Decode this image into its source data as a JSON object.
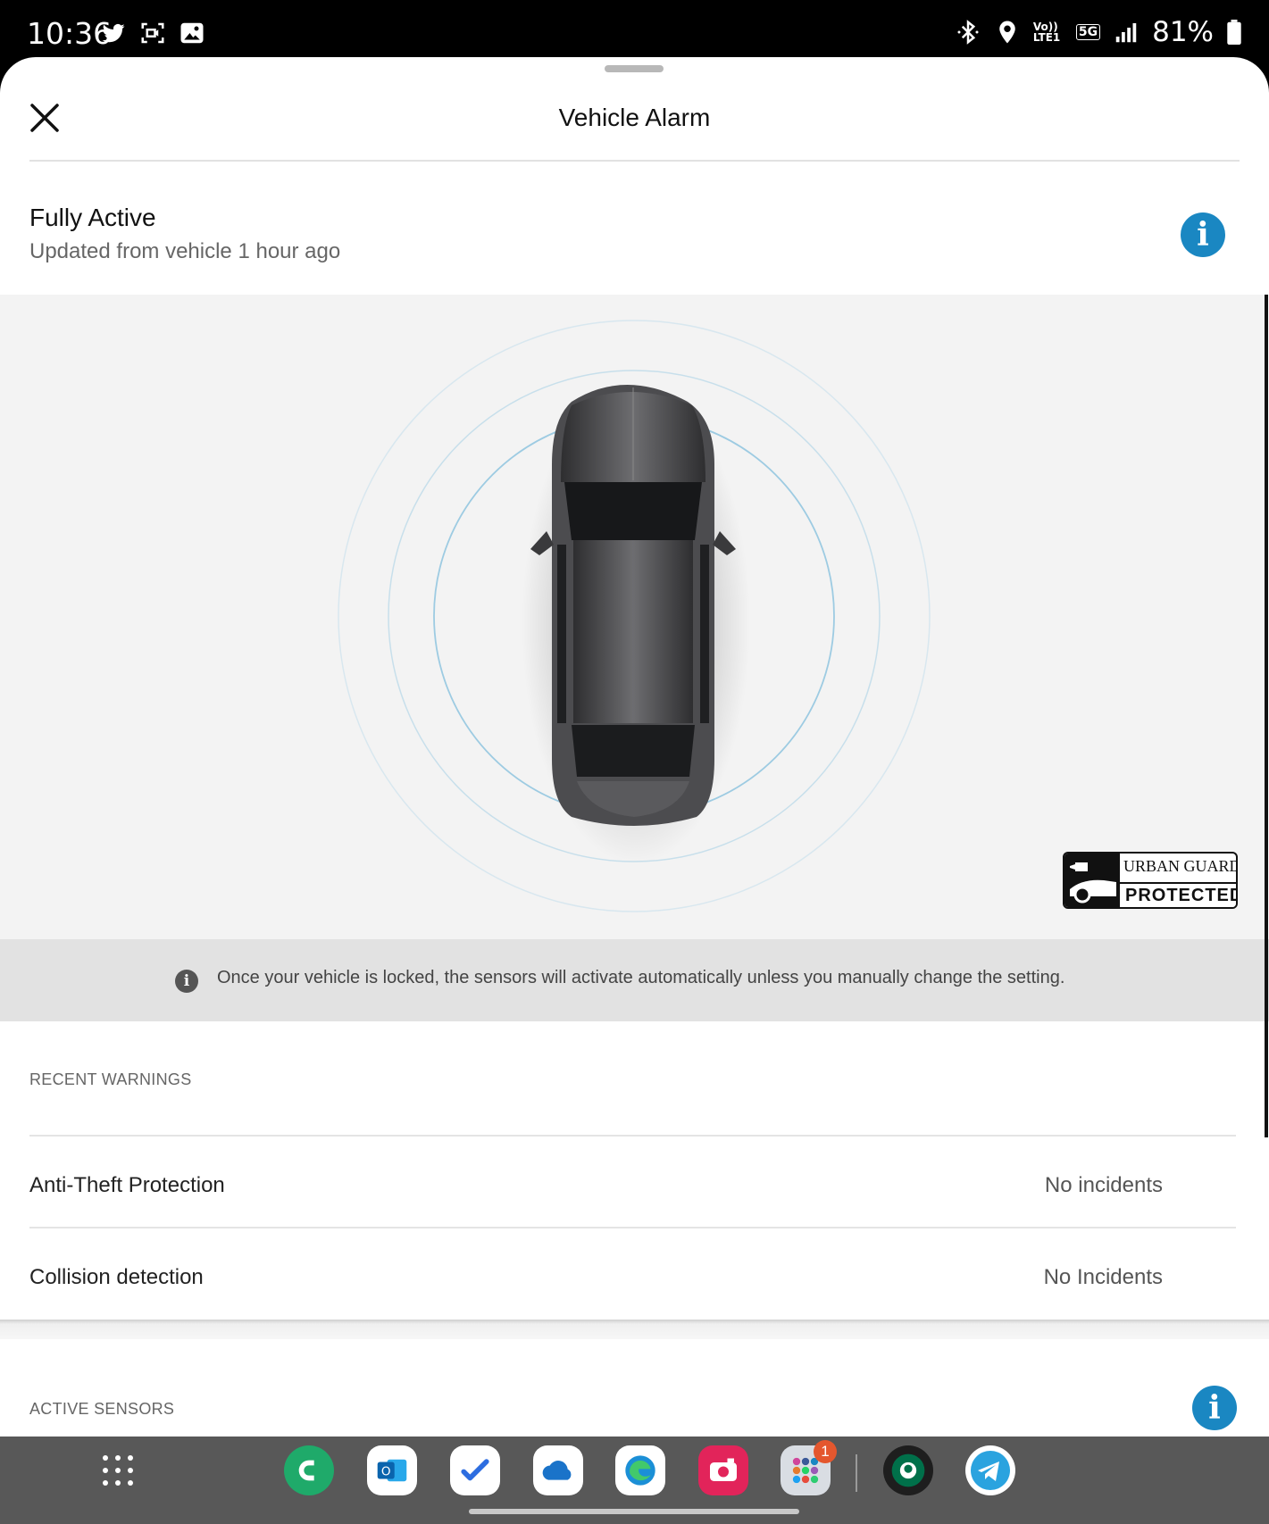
{
  "status_bar": {
    "time": "10:36",
    "network": "Vo)) LTE1",
    "network_gen": "5G",
    "battery": "81%"
  },
  "header": {
    "title": "Vehicle Alarm"
  },
  "status": {
    "title": "Fully Active",
    "subtitle": "Updated from vehicle 1 hour ago"
  },
  "badge": {
    "line1": "URBAN GUARD",
    "line2": "PROTECTED"
  },
  "notice": {
    "text": "Once your vehicle is locked, the sensors will activate automatically unless you manually change the setting."
  },
  "recent_warnings": {
    "label": "RECENT WARNINGS",
    "rows": [
      {
        "label": "Anti-Theft Protection",
        "value": "No incidents"
      },
      {
        "label": "Collision detection",
        "value": "No Incidents"
      }
    ]
  },
  "active_sensors": {
    "label": "ACTIVE SENSORS"
  },
  "dock": {
    "notification_count": "1",
    "apps": [
      "phone-app-icon",
      "outlook-app-icon",
      "todo-app-icon",
      "onedrive-app-icon",
      "edge-app-icon",
      "camera-app-icon",
      "social-folder-icon",
      "starbucks-app-icon",
      "telegram-app-icon"
    ]
  },
  "colors": {
    "accent": "#1a87c2",
    "car_area_bg": "#f3f3f3",
    "notice_bg": "#e2e2e2",
    "dock_bg": "#585858"
  }
}
